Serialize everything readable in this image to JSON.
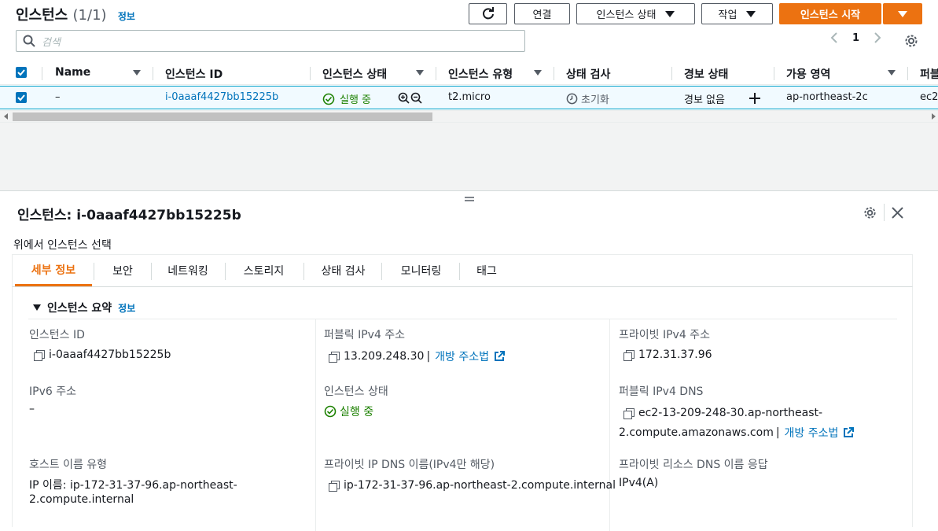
{
  "header": {
    "title": "인스턴스",
    "count": "(1/1)",
    "info_link": "정보",
    "refresh_icon": "refresh-icon",
    "connect_label": "연결",
    "instance_state_label": "인스턴스 상태",
    "actions_label": "작업",
    "launch_label": "인스턴스 시작"
  },
  "search": {
    "placeholder": "검색"
  },
  "pager": {
    "page": "1"
  },
  "table": {
    "columns": [
      "Name",
      "인스턴스 ID",
      "인스턴스 상태",
      "인스턴스 유형",
      "상태 검사",
      "경보 상태",
      "가용 영역",
      "퍼블"
    ],
    "row": {
      "name": "–",
      "instance_id": "i-0aaaf4427bb15225b",
      "state": "실행 중",
      "type": "t2.micro",
      "status_check": "초기화",
      "alarm": "경보 없음",
      "az": "ap-northeast-2c",
      "public": "ec2"
    }
  },
  "detail": {
    "title": "인스턴스: i-0aaaf4427bb15225b",
    "subtitle": "위에서 인스턴스 선택",
    "tabs": [
      "세부 정보",
      "보안",
      "네트워킹",
      "스토리지",
      "상태 검사",
      "모니터링",
      "태그"
    ],
    "section_title": "인스턴스 요약",
    "section_info": "정보",
    "fields": {
      "instance_id_label": "인스턴스 ID",
      "instance_id": "i-0aaaf4427bb15225b",
      "public_ipv4_label": "퍼블릭 IPv4 주소",
      "public_ipv4": "13.209.248.30",
      "open_address": "개방 주소법",
      "private_ipv4_label": "프라이빗 IPv4 주소",
      "private_ipv4": "172.31.37.96",
      "ipv6_label": "IPv6 주소",
      "ipv6": "–",
      "state_label": "인스턴스 상태",
      "state": "실행 중",
      "public_dns_label": "퍼블릭 IPv4 DNS",
      "public_dns_line1": "ec2-13-209-248-30.ap-northeast-",
      "public_dns_line2": "2.compute.amazonaws.com",
      "public_dns_link": "개방 주소법",
      "hostname_type_label": "호스트 이름 유형",
      "hostname_type_line1": "IP 이름: ip-172-31-37-96.ap-northeast-",
      "hostname_type_line2": "2.compute.internal",
      "private_dns_label": "프라이빗 IP DNS 이름(IPv4만 해당)",
      "private_dns": "ip-172-31-37-96.ap-northeast-2.compute.internal",
      "private_resource_dns_label": "프라이빗 리소스 DNS 이름 응답",
      "private_resource_dns": "IPv4(A)"
    }
  },
  "colors": {
    "accent": "#ec7211",
    "link": "#0073bb",
    "success": "#1d8102"
  }
}
